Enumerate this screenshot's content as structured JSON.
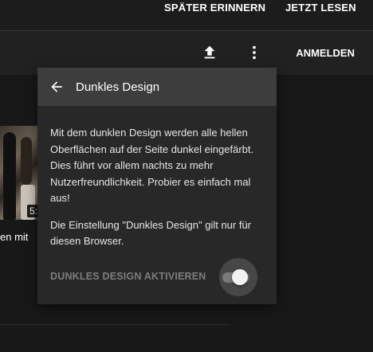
{
  "notice": {
    "remind_later": "SPÄTER ERINNERN",
    "read_now": "JETZT LESEN"
  },
  "header": {
    "upload_icon": "upload-icon",
    "more_icon": "more-vert-icon",
    "signin": "ANMELDEN"
  },
  "video": {
    "duration": "5:",
    "title_fragment": "en mit"
  },
  "popup": {
    "title": "Dunkles Design",
    "description": "Mit dem dunklen Design werden alle hellen Oberflächen auf der Seite dunkel eingefärbt. Dies führt vor allem nachts zu mehr Nutzerfreundlichkeit. Probier es einfach mal aus!",
    "note": "Die Einstellung \"Dunkles Design\" gilt nur für diesen Browser.",
    "toggle_label": "DUNKLES DESIGN AKTIVIEREN",
    "toggle_state": "off"
  },
  "colors": {
    "page_bg": "#181818",
    "header_bg": "#212121",
    "popup_bg": "#282828",
    "popup_header_bg": "#3d3d3d"
  }
}
